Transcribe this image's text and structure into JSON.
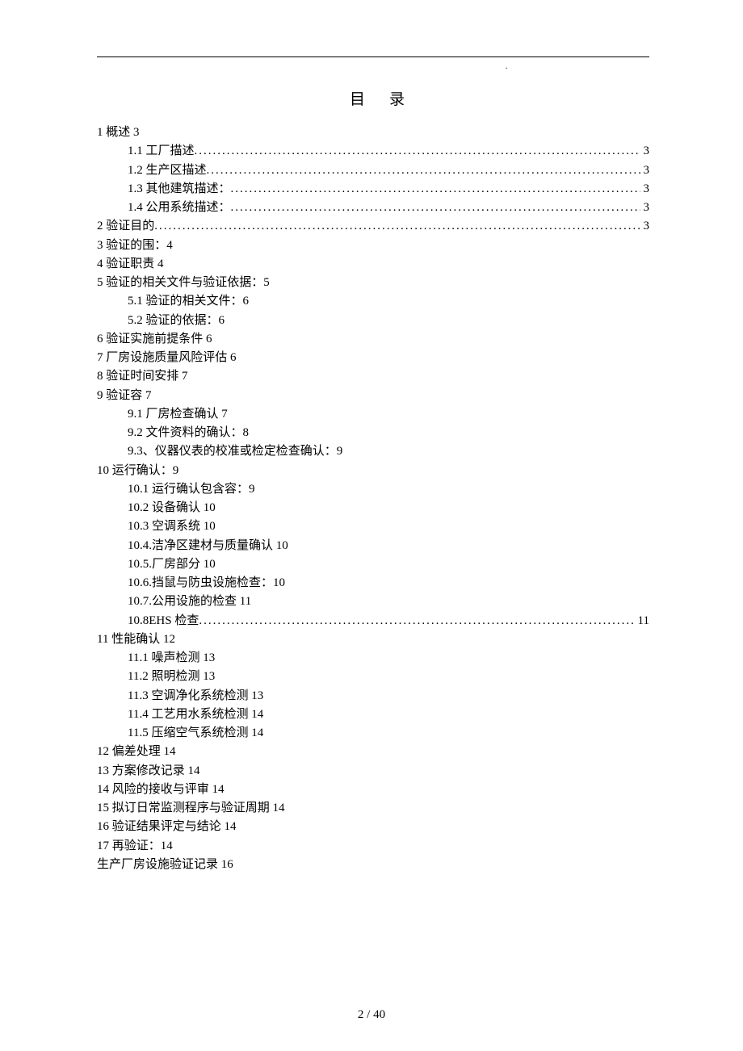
{
  "title": "目录",
  "footer": "2 / 40",
  "toc": [
    {
      "level": 0,
      "label": "1 概述 3",
      "dotted": false
    },
    {
      "level": 1,
      "label": "1.1 工厂描述",
      "dotted": true,
      "page": "3"
    },
    {
      "level": 1,
      "label": "1.2 生产区描述",
      "dotted": true,
      "page": "3"
    },
    {
      "level": 1,
      "label": "1.3 其他建筑描述：",
      "dotted": true,
      "page": "3"
    },
    {
      "level": 1,
      "label": "1.4 公用系统描述：",
      "dotted": true,
      "page": "3"
    },
    {
      "level": 0,
      "label": "2 验证目的",
      "dotted": true,
      "page": "3"
    },
    {
      "level": 0,
      "label": "3 验证的围：4",
      "dotted": false
    },
    {
      "level": 0,
      "label": "4 验证职责 4",
      "dotted": false
    },
    {
      "level": 0,
      "label": "5 验证的相关文件与验证依据：5",
      "dotted": false
    },
    {
      "level": 1,
      "label": "5.1 验证的相关文件：6",
      "dotted": false
    },
    {
      "level": 1,
      "label": "5.2 验证的依据：6",
      "dotted": false
    },
    {
      "level": 0,
      "label": "6 验证实施前提条件 6",
      "dotted": false
    },
    {
      "level": 0,
      "label": "7 厂房设施质量风险评估 6",
      "dotted": false
    },
    {
      "level": 0,
      "label": "8 验证时间安排 7",
      "dotted": false
    },
    {
      "level": 0,
      "label": "9 验证容 7",
      "dotted": false
    },
    {
      "level": 1,
      "label": "9.1 厂房检查确认 7",
      "dotted": false
    },
    {
      "level": 1,
      "label": "9.2 文件资料的确认：8",
      "dotted": false
    },
    {
      "level": 1,
      "label": "9.3、仪器仪表的校准或检定检查确认：9",
      "dotted": false
    },
    {
      "level": 0,
      "label": "10 运行确认：9",
      "dotted": false
    },
    {
      "level": 1,
      "label": "10.1 运行确认包含容：9",
      "dotted": false
    },
    {
      "level": 1,
      "label": "10.2 设备确认 10",
      "dotted": false
    },
    {
      "level": 1,
      "label": "10.3 空调系统 10",
      "dotted": false
    },
    {
      "level": 1,
      "label": "10.4.洁净区建材与质量确认 10",
      "dotted": false
    },
    {
      "level": 1,
      "label": "10.5.厂房部分 10",
      "dotted": false
    },
    {
      "level": 1,
      "label": "10.6.挡鼠与防虫设施检查：10",
      "dotted": false
    },
    {
      "level": 1,
      "label": "10.7.公用设施的检查 11",
      "dotted": false
    },
    {
      "level": 1,
      "label": "10.8EHS 检查",
      "dotted": true,
      "page": "11"
    },
    {
      "level": 0,
      "label": "11 性能确认 12",
      "dotted": false
    },
    {
      "level": 1,
      "label": "11.1 噪声检测 13",
      "dotted": false
    },
    {
      "level": 1,
      "label": "11.2 照明检测 13",
      "dotted": false
    },
    {
      "level": 1,
      "label": "11.3 空调净化系统检测 13",
      "dotted": false
    },
    {
      "level": 1,
      "label": "11.4 工艺用水系统检测 14",
      "dotted": false
    },
    {
      "level": 1,
      "label": "11.5 压缩空气系统检测 14",
      "dotted": false
    },
    {
      "level": 0,
      "label": "12 偏差处理 14",
      "dotted": false
    },
    {
      "level": 0,
      "label": "13 方案修改记录 14",
      "dotted": false
    },
    {
      "level": 0,
      "label": "14 风险的接收与评审 14",
      "dotted": false
    },
    {
      "level": 0,
      "label": "15 拟订日常监测程序与验证周期 14",
      "dotted": false
    },
    {
      "level": 0,
      "label": "16 验证结果评定与结论 14",
      "dotted": false
    },
    {
      "level": 0,
      "label": "17 再验证：14",
      "dotted": false
    },
    {
      "level": 0,
      "label": "生产厂房设施验证记录 16",
      "dotted": false
    }
  ]
}
